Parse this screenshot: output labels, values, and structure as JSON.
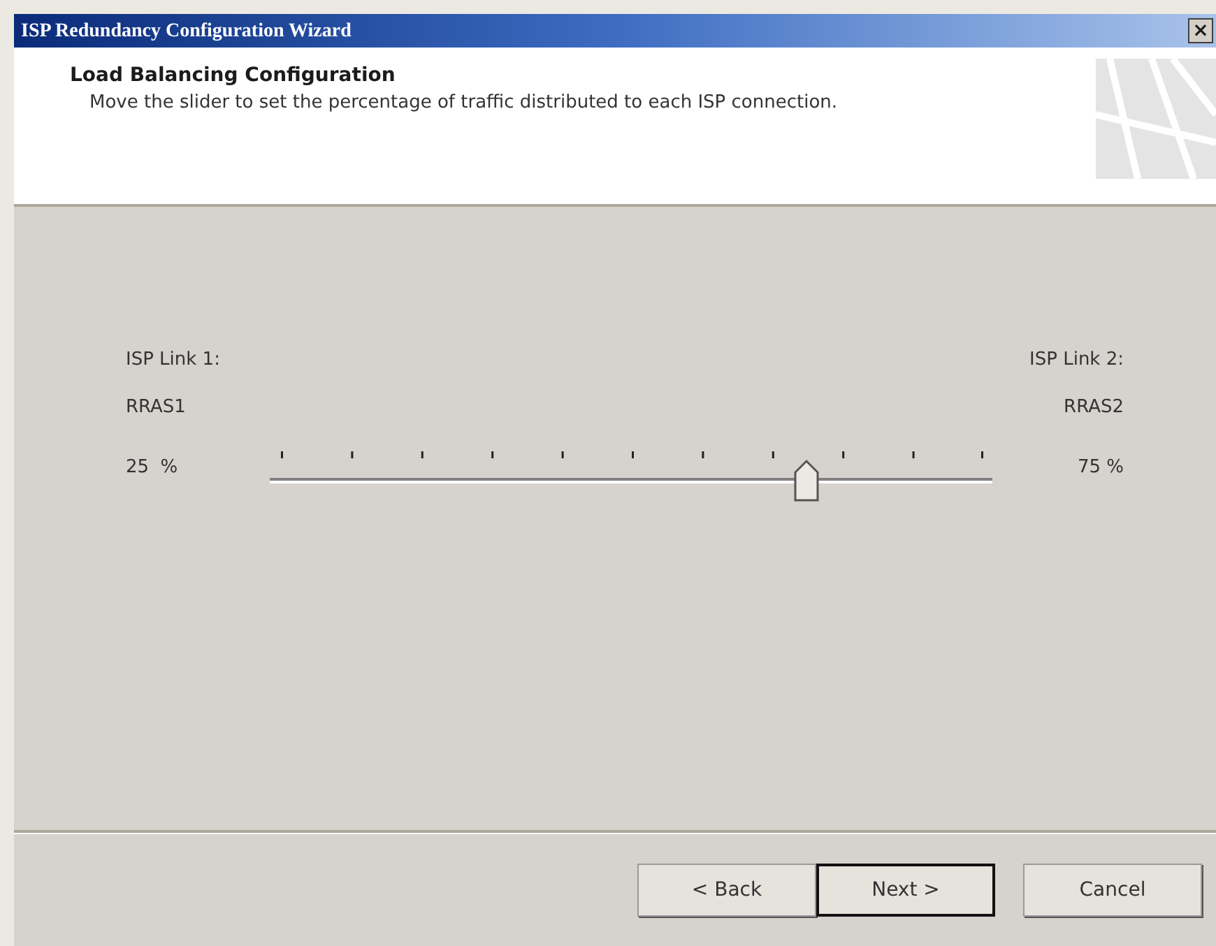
{
  "window": {
    "title": "ISP Redundancy Configuration Wizard",
    "close": "×"
  },
  "header": {
    "title": "Load Balancing Configuration",
    "description": "Move the slider to set the percentage of traffic distributed to each ISP connection."
  },
  "links": [
    {
      "label": "ISP Link 1:",
      "name": "RRAS1",
      "percent": "25  %"
    },
    {
      "label": "ISP Link 2:",
      "name": "RRAS2",
      "percent": "75 %"
    }
  ],
  "slider": {
    "level": 0.743
  },
  "buttons": [
    {
      "label": "< Back",
      "default": false
    },
    {
      "label": "Next >",
      "default": true
    },
    {
      "label": "Cancel",
      "default": false
    }
  ]
}
